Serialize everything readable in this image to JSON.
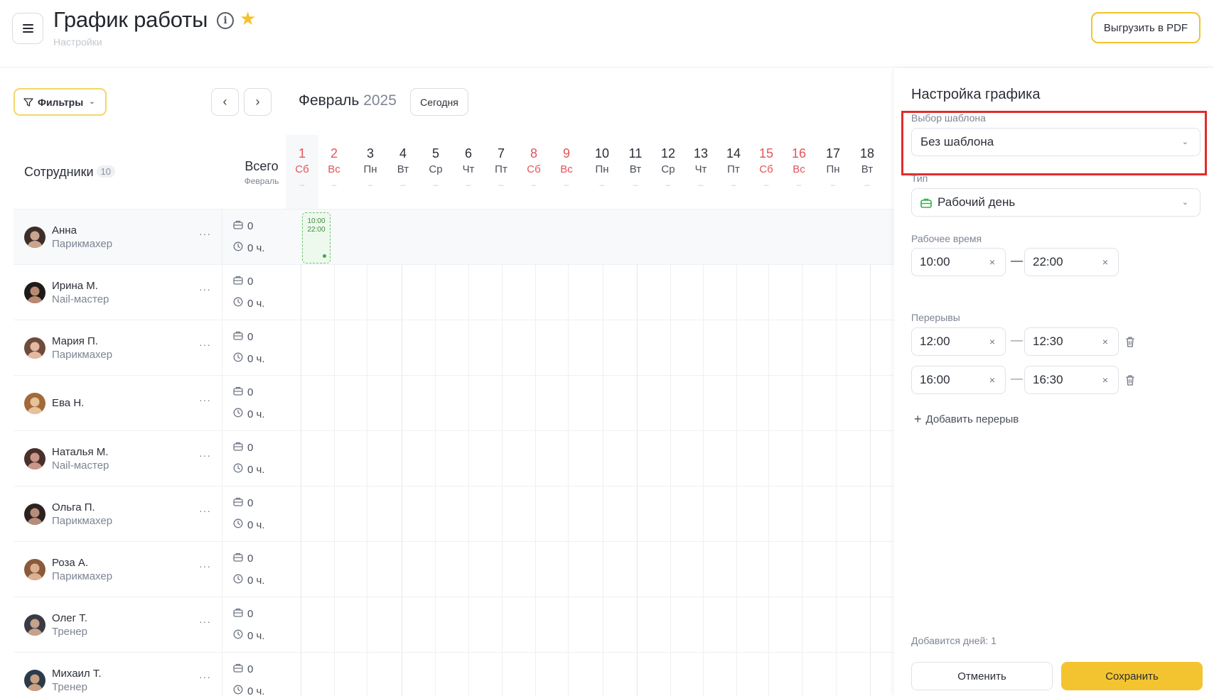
{
  "header": {
    "title": "График работы",
    "subtitle": "Настройки",
    "pdf_label": "Выгрузить в PDF"
  },
  "toolbar": {
    "filters_label": "Фильтры",
    "month": "Февраль",
    "year": "2025",
    "today_label": "Сегодня"
  },
  "grid": {
    "employees_label": "Сотрудники",
    "employees_count": "10",
    "total_label": "Всего",
    "total_sub": "Февраль",
    "days": [
      {
        "n": "1",
        "w": "Сб",
        "weekend": true
      },
      {
        "n": "2",
        "w": "Вс",
        "weekend": true
      },
      {
        "n": "3",
        "w": "Пн",
        "weekend": false
      },
      {
        "n": "4",
        "w": "Вт",
        "weekend": false
      },
      {
        "n": "5",
        "w": "Ср",
        "weekend": false
      },
      {
        "n": "6",
        "w": "Чт",
        "weekend": false
      },
      {
        "n": "7",
        "w": "Пт",
        "weekend": false
      },
      {
        "n": "8",
        "w": "Сб",
        "weekend": true
      },
      {
        "n": "9",
        "w": "Вс",
        "weekend": true
      },
      {
        "n": "10",
        "w": "Пн",
        "weekend": false
      },
      {
        "n": "11",
        "w": "Вт",
        "weekend": false
      },
      {
        "n": "12",
        "w": "Ср",
        "weekend": false
      },
      {
        "n": "13",
        "w": "Чт",
        "weekend": false
      },
      {
        "n": "14",
        "w": "Пт",
        "weekend": false
      },
      {
        "n": "15",
        "w": "Сб",
        "weekend": true
      },
      {
        "n": "16",
        "w": "Вс",
        "weekend": true
      },
      {
        "n": "17",
        "w": "Пн",
        "weekend": false
      },
      {
        "n": "18",
        "w": "Вт",
        "weekend": false
      }
    ],
    "day_dash": "–",
    "employees": [
      {
        "name": "Анна",
        "role": "Парикмахер",
        "shifts": "0",
        "hours": "0 ч."
      },
      {
        "name": "Ирина М.",
        "role": "Nail-мастер",
        "shifts": "0",
        "hours": "0 ч."
      },
      {
        "name": "Мария П.",
        "role": "Парикмахер",
        "shifts": "0",
        "hours": "0 ч."
      },
      {
        "name": "Ева Н.",
        "role": "",
        "shifts": "0",
        "hours": "0 ч."
      },
      {
        "name": "Наталья М.",
        "role": "Nail-мастер",
        "shifts": "0",
        "hours": "0 ч."
      },
      {
        "name": "Ольга П.",
        "role": "Парикмахер",
        "shifts": "0",
        "hours": "0 ч."
      },
      {
        "name": "Роза А.",
        "role": "Парикмахер",
        "shifts": "0",
        "hours": "0 ч."
      },
      {
        "name": "Олег Т.",
        "role": "Тренер",
        "shifts": "0",
        "hours": "0 ч."
      },
      {
        "name": "Михаил Т.",
        "role": "Тренер",
        "shifts": "0",
        "hours": "0 ч."
      }
    ],
    "shift_card": {
      "start": "10:00",
      "end": "22:00"
    }
  },
  "panel": {
    "title": "Настройка графика",
    "template_label": "Выбор шаблона",
    "template_value": "Без шаблона",
    "type_label": "Тип",
    "type_value": "Рабочий день",
    "work_time_label": "Рабочее время",
    "work_start": "10:00",
    "work_end": "22:00",
    "breaks_label": "Перерывы",
    "breaks": [
      {
        "start": "12:00",
        "end": "12:30"
      },
      {
        "start": "16:00",
        "end": "16:30"
      }
    ],
    "add_break_label": "Добавить перерыв",
    "days_note": "Добавится дней: 1",
    "cancel_label": "Отменить",
    "save_label": "Сохранить"
  },
  "colors": {
    "accent": "#f4c430",
    "weekend": "#e2555a",
    "highlight": "#e22b2b",
    "shift": "#6ec46e"
  }
}
